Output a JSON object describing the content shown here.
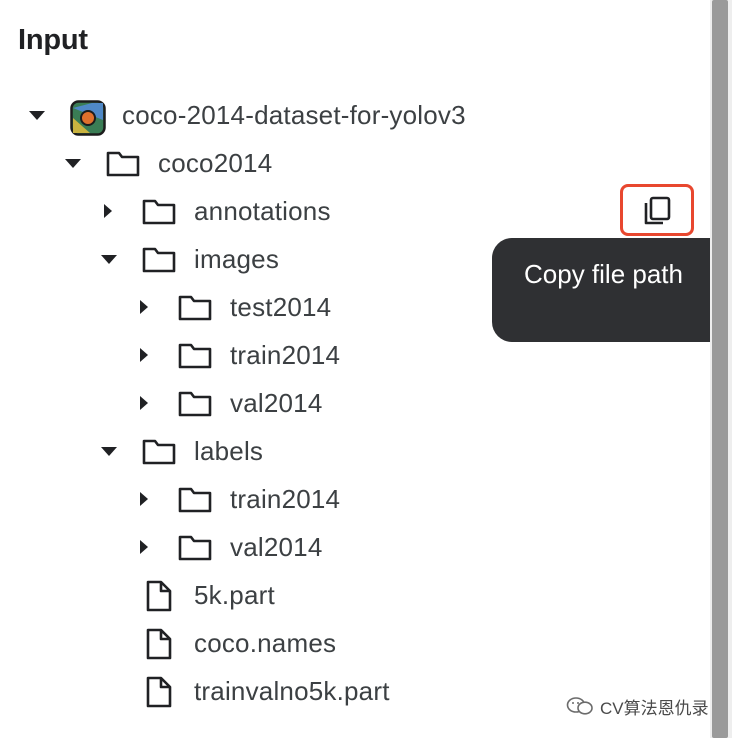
{
  "panel": {
    "title": "Input"
  },
  "tree": {
    "dataset": "coco-2014-dataset-for-yolov3",
    "root_folder": "coco2014",
    "annotations": "annotations",
    "images": "images",
    "test2014": "test2014",
    "images_train2014": "train2014",
    "images_val2014": "val2014",
    "labels": "labels",
    "labels_train2014": "train2014",
    "labels_val2014": "val2014",
    "file_5k": "5k.part",
    "file_names": "coco.names",
    "file_trainval": "trainvalno5k.part"
  },
  "tooltip": {
    "text": "Copy file path"
  },
  "watermark": {
    "text": "CV算法恩仇录"
  },
  "icons": {
    "dataset": "kaggle-dataset-icon",
    "folder": "folder-icon",
    "file": "file-icon",
    "copy": "copy-icon"
  },
  "colors": {
    "highlight": "#e8472f",
    "tooltip_bg": "#2f3033"
  }
}
